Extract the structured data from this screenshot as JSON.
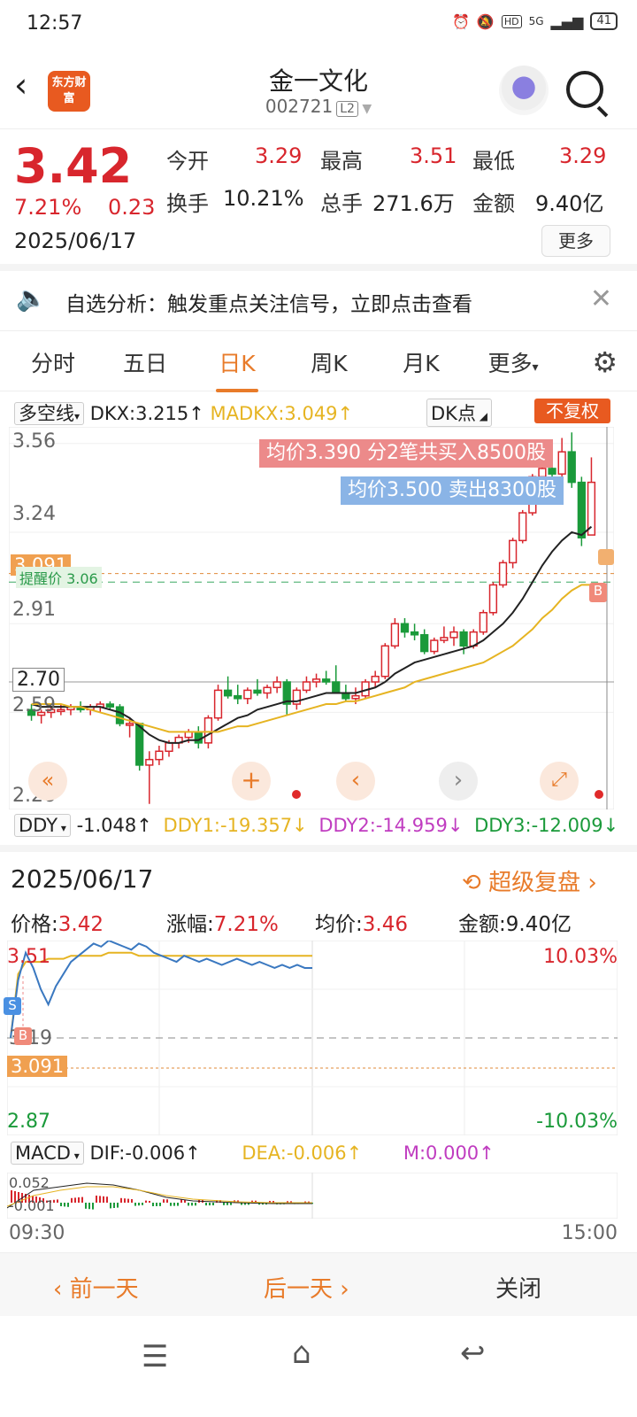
{
  "status_bar": {
    "time": "12:57",
    "network": "5G",
    "battery": "41"
  },
  "header": {
    "logo_text": "东方财富",
    "title": "金一文化",
    "code": "002721",
    "level": "L2"
  },
  "quote": {
    "price": "3.42",
    "change_pct": "7.21%",
    "change": "0.23",
    "date": "2025/06/17",
    "fields": [
      {
        "label": "今开",
        "value": "3.29"
      },
      {
        "label": "最高",
        "value": "3.51"
      },
      {
        "label": "最低",
        "value": "3.29"
      },
      {
        "label": "换手",
        "value": "10.21%"
      },
      {
        "label": "总手",
        "value": "271.6万"
      },
      {
        "label": "金额",
        "value": "9.40亿"
      }
    ],
    "more_label": "更多"
  },
  "notice": {
    "text": "自选分析：触发重点关注信号，立即点击查看"
  },
  "tabs": [
    "分时",
    "五日",
    "日K",
    "周K",
    "月K",
    "更多"
  ],
  "active_tab": "日K",
  "kline": {
    "indicator_select": "多空线",
    "dkx": "DKX:3.215↑",
    "madkx": "MADKX:3.049↑",
    "dk_point": "DK点",
    "adjust": "不复权",
    "y_labels": [
      "3.56",
      "3.24",
      "2.91",
      "2.59",
      "2.26"
    ],
    "cursor_price": "2.70",
    "avg_cost": "3.091",
    "alert_label": "提醒价",
    "alert_price": "3.06",
    "buy_note": "均价3.390    分2笔共买入8500股",
    "sell_note": "均价3.500    卖出8300股",
    "buy_marker": "B",
    "candles": [
      [
        2.6,
        2.62,
        2.56,
        2.58
      ],
      [
        2.58,
        2.6,
        2.55,
        2.59
      ],
      [
        2.59,
        2.61,
        2.57,
        2.6
      ],
      [
        2.6,
        2.62,
        2.58,
        2.6
      ],
      [
        2.6,
        2.62,
        2.58,
        2.61
      ],
      [
        2.61,
        2.63,
        2.59,
        2.6
      ],
      [
        2.6,
        2.62,
        2.58,
        2.61
      ],
      [
        2.61,
        2.63,
        2.59,
        2.62
      ],
      [
        2.62,
        2.63,
        2.6,
        2.61
      ],
      [
        2.61,
        2.62,
        2.54,
        2.55
      ],
      [
        2.55,
        2.57,
        2.5,
        2.55
      ],
      [
        2.55,
        2.55,
        2.38,
        2.4
      ],
      [
        2.4,
        2.45,
        2.26,
        2.42
      ],
      [
        2.42,
        2.47,
        2.4,
        2.45
      ],
      [
        2.45,
        2.49,
        2.43,
        2.48
      ],
      [
        2.48,
        2.51,
        2.46,
        2.5
      ],
      [
        2.5,
        2.53,
        2.48,
        2.52
      ],
      [
        2.52,
        2.54,
        2.46,
        2.48
      ],
      [
        2.48,
        2.58,
        2.46,
        2.57
      ],
      [
        2.57,
        2.69,
        2.56,
        2.67
      ],
      [
        2.67,
        2.72,
        2.64,
        2.65
      ],
      [
        2.65,
        2.69,
        2.62,
        2.64
      ],
      [
        2.64,
        2.68,
        2.62,
        2.67
      ],
      [
        2.67,
        2.71,
        2.65,
        2.66
      ],
      [
        2.66,
        2.69,
        2.64,
        2.68
      ],
      [
        2.68,
        2.72,
        2.66,
        2.7
      ],
      [
        2.7,
        2.71,
        2.58,
        2.62
      ],
      [
        2.62,
        2.68,
        2.6,
        2.67
      ],
      [
        2.67,
        2.72,
        2.66,
        2.7
      ],
      [
        2.7,
        2.73,
        2.68,
        2.71
      ],
      [
        2.71,
        2.74,
        2.69,
        2.7
      ],
      [
        2.7,
        2.76,
        2.69,
        2.66
      ],
      [
        2.66,
        2.69,
        2.63,
        2.64
      ],
      [
        2.64,
        2.68,
        2.62,
        2.65
      ],
      [
        2.65,
        2.71,
        2.64,
        2.7
      ],
      [
        2.7,
        2.74,
        2.68,
        2.72
      ],
      [
        2.72,
        2.84,
        2.71,
        2.83
      ],
      [
        2.83,
        2.93,
        2.82,
        2.91
      ],
      [
        2.91,
        2.93,
        2.86,
        2.88
      ],
      [
        2.88,
        2.91,
        2.85,
        2.87
      ],
      [
        2.87,
        2.89,
        2.8,
        2.81
      ],
      [
        2.81,
        2.86,
        2.8,
        2.85
      ],
      [
        2.85,
        2.9,
        2.84,
        2.86
      ],
      [
        2.86,
        2.9,
        2.83,
        2.88
      ],
      [
        2.88,
        2.89,
        2.8,
        2.83
      ],
      [
        2.83,
        2.89,
        2.82,
        2.88
      ],
      [
        2.88,
        2.96,
        2.87,
        2.95
      ],
      [
        2.95,
        3.06,
        2.94,
        3.05
      ],
      [
        3.05,
        3.14,
        3.04,
        3.13
      ],
      [
        3.13,
        3.22,
        3.11,
        3.21
      ],
      [
        3.21,
        3.32,
        3.2,
        3.31
      ],
      [
        3.31,
        3.45,
        3.3,
        3.44
      ],
      [
        3.44,
        3.51,
        3.41,
        3.47
      ],
      [
        3.47,
        3.54,
        3.43,
        3.45
      ],
      [
        3.45,
        3.58,
        3.42,
        3.53
      ],
      [
        3.53,
        3.6,
        3.4,
        3.42
      ],
      [
        3.42,
        3.44,
        3.19,
        3.22
      ],
      [
        3.23,
        3.51,
        3.23,
        3.42
      ]
    ],
    "dkx_line": [
      2.62,
      2.61,
      2.61,
      2.61,
      2.61,
      2.61,
      2.61,
      2.61,
      2.6,
      2.59,
      2.57,
      2.54,
      2.51,
      2.49,
      2.48,
      2.48,
      2.49,
      2.49,
      2.51,
      2.53,
      2.55,
      2.57,
      2.58,
      2.6,
      2.61,
      2.62,
      2.63,
      2.63,
      2.64,
      2.65,
      2.66,
      2.66,
      2.66,
      2.66,
      2.67,
      2.68,
      2.7,
      2.73,
      2.75,
      2.77,
      2.78,
      2.79,
      2.8,
      2.81,
      2.82,
      2.83,
      2.85,
      2.88,
      2.91,
      2.95,
      3.0,
      3.06,
      3.12,
      3.17,
      3.21,
      3.24,
      3.23,
      3.26
    ],
    "madkx_line": [
      2.62,
      2.62,
      2.62,
      2.62,
      2.61,
      2.61,
      2.6,
      2.59,
      2.58,
      2.57,
      2.56,
      2.55,
      2.54,
      2.53,
      2.52,
      2.52,
      2.52,
      2.52,
      2.52,
      2.52,
      2.53,
      2.54,
      2.54,
      2.55,
      2.56,
      2.57,
      2.58,
      2.59,
      2.6,
      2.61,
      2.62,
      2.62,
      2.63,
      2.63,
      2.64,
      2.65,
      2.66,
      2.67,
      2.68,
      2.7,
      2.71,
      2.72,
      2.73,
      2.74,
      2.75,
      2.76,
      2.77,
      2.79,
      2.81,
      2.83,
      2.86,
      2.89,
      2.93,
      2.96,
      3.0,
      3.03,
      3.05,
      3.05
    ],
    "y_range": [
      2.24,
      3.62
    ]
  },
  "ddy": {
    "select": "DDY",
    "value": "-1.048↑",
    "ddy1": "DDY1:-19.357↓",
    "ddy2": "DDY2:-14.959↓",
    "ddy3": "DDY3:-12.009↓"
  },
  "intraday": {
    "date": "2025/06/17",
    "replay_label": "超级复盘",
    "price_label": "价格:",
    "price": "3.42",
    "change_label": "涨幅:",
    "change": "7.21%",
    "avg_label": "均价:",
    "avg": "3.46",
    "amount_label": "金额:",
    "amount": "9.40亿",
    "top_price": "3.51",
    "top_pct": "10.03%",
    "bottom_price": "2.87",
    "bottom_pct": "-10.03%",
    "mid_price": "3.19",
    "avg_cost": "3.091",
    "sell_marker": "S",
    "buy_marker": "B",
    "start_time": "09:30",
    "end_time": "15:00",
    "price_line": [
      3.19,
      3.38,
      3.47,
      3.42,
      3.35,
      3.3,
      3.36,
      3.4,
      3.44,
      3.46,
      3.48,
      3.5,
      3.49,
      3.51,
      3.5,
      3.49,
      3.48,
      3.5,
      3.49,
      3.47,
      3.46,
      3.45,
      3.44,
      3.46,
      3.45,
      3.44,
      3.45,
      3.44,
      3.43,
      3.44,
      3.45,
      3.44,
      3.43,
      3.44,
      3.43,
      3.42,
      3.43,
      3.42,
      3.43,
      3.42,
      3.42
    ],
    "avg_line": [
      3.19,
      3.4,
      3.44,
      3.44,
      3.44,
      3.45,
      3.45,
      3.45,
      3.46,
      3.46,
      3.46,
      3.46,
      3.46,
      3.47,
      3.47,
      3.47,
      3.47,
      3.46,
      3.46,
      3.46,
      3.46,
      3.46,
      3.46,
      3.46,
      3.46,
      3.46,
      3.46,
      3.46,
      3.46,
      3.46,
      3.46,
      3.46,
      3.46,
      3.46,
      3.46,
      3.46,
      3.46,
      3.46,
      3.46,
      3.46,
      3.46
    ],
    "y_range": [
      2.87,
      3.51
    ]
  },
  "macd": {
    "select": "MACD",
    "dif": "DIF:-0.006↑",
    "dea": "DEA:-0.006↑",
    "m": "M:0.000↑",
    "top": "0.052",
    "bottom": "-0.001"
  },
  "bottom_nav": {
    "prev": "前一天",
    "next": "后一天",
    "close": "关闭"
  },
  "colors": {
    "up": "#d8262d",
    "down": "#1a9a3a",
    "accent": "#e87b2a",
    "dkx": "#222222",
    "madkx": "#e6b422"
  }
}
